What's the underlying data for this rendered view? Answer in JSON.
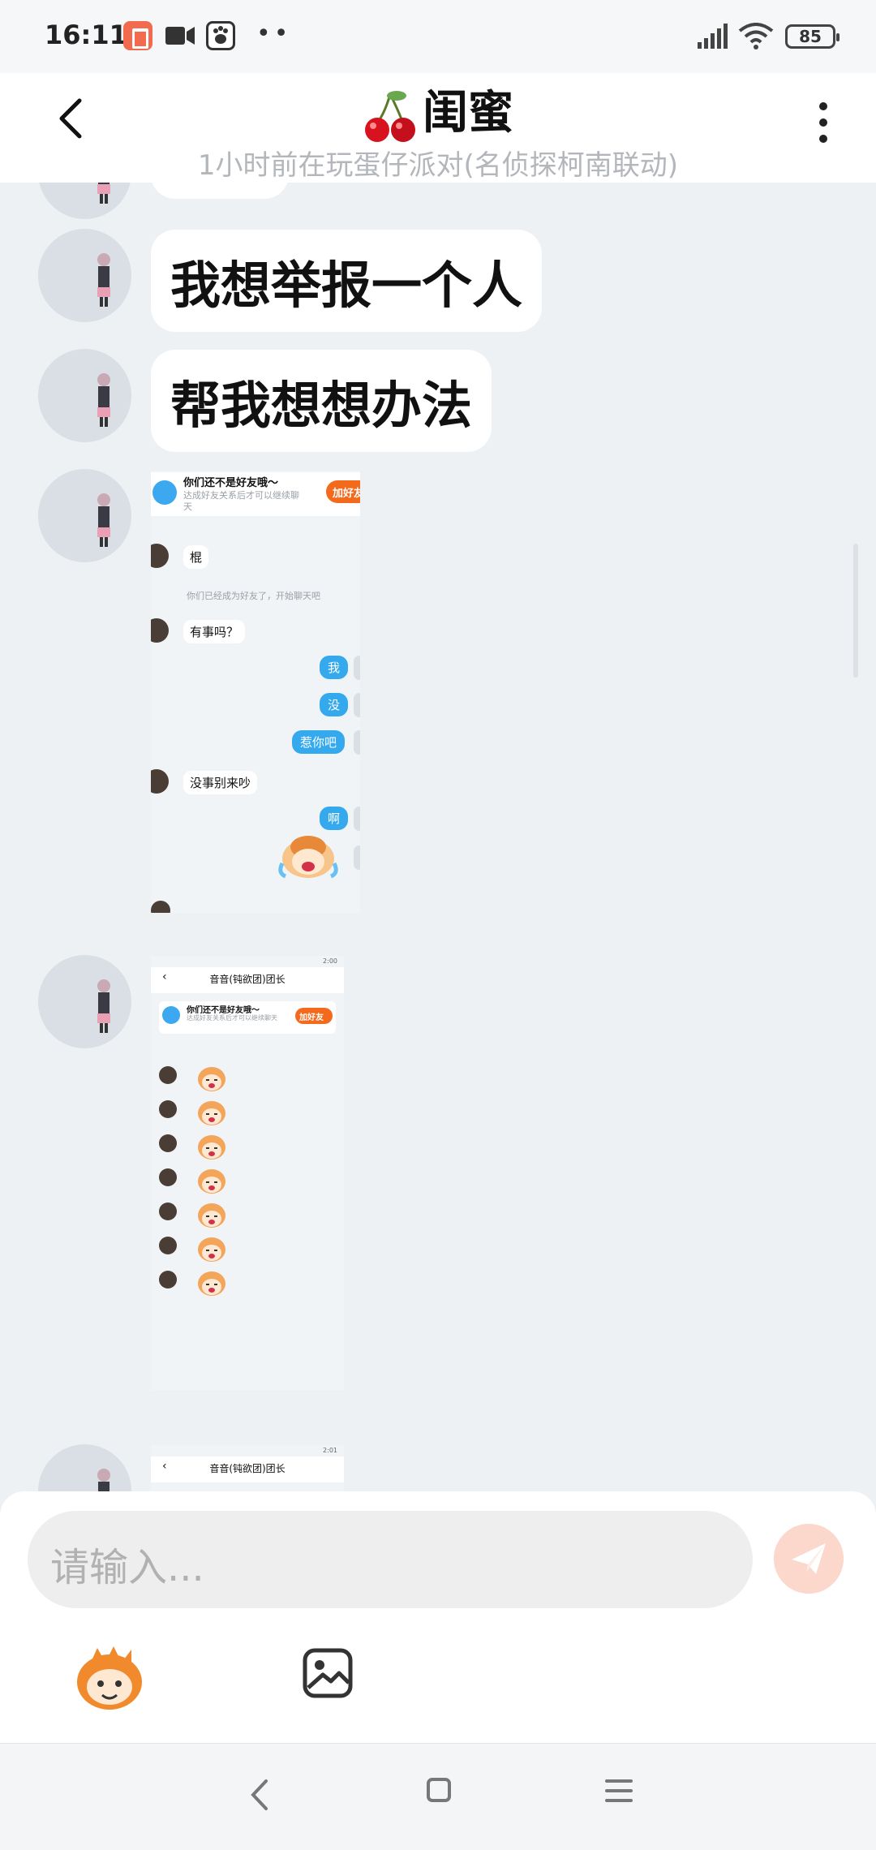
{
  "status_bar": {
    "time": "16:11",
    "battery": "85",
    "icons": [
      "notification-app-icon",
      "video-camera-icon",
      "baidu-paw-icon",
      "more-dots-icon",
      "signal-icon",
      "wifi-icon",
      "battery-icon"
    ],
    "dots": "••"
  },
  "header": {
    "title": "闺蜜",
    "subtitle": "1小时前在玩蛋仔派对(名侦探柯南联动)"
  },
  "messages": [
    {
      "type": "text",
      "text": "我想举报一个人"
    },
    {
      "type": "text",
      "text": "帮我想想办法"
    },
    {
      "type": "image",
      "banner_title": "你们还不是好友哦～",
      "banner_sub": "达成好友关系后才可以继续聊天",
      "banner_add": "加好友",
      "lines": {
        "l1": "棍",
        "sys": "你们已经成为好友了，开始聊天吧",
        "l2": "有事吗？",
        "r1": "我",
        "r2": "没",
        "r3": "惹你吧",
        "l3": "没事别来吵",
        "r4": "啊"
      }
    },
    {
      "type": "image",
      "status_time": "2:00",
      "chat_title": "音音(钝欲团)团长",
      "banner_title": "你们还不是好友哦～",
      "banner_sub": "达成好友关系后才可以继续聊天",
      "banner_add": "加好友",
      "sticker_count": 7
    },
    {
      "type": "image",
      "status_time": "2:01",
      "chat_title": "音音(钝欲团)团长"
    }
  ],
  "input": {
    "placeholder": "请输入..."
  },
  "colors": {
    "accent_blue": "#35a9ee",
    "accent_orange": "#f36a1d",
    "send_disabled": "#fbd7cc"
  }
}
